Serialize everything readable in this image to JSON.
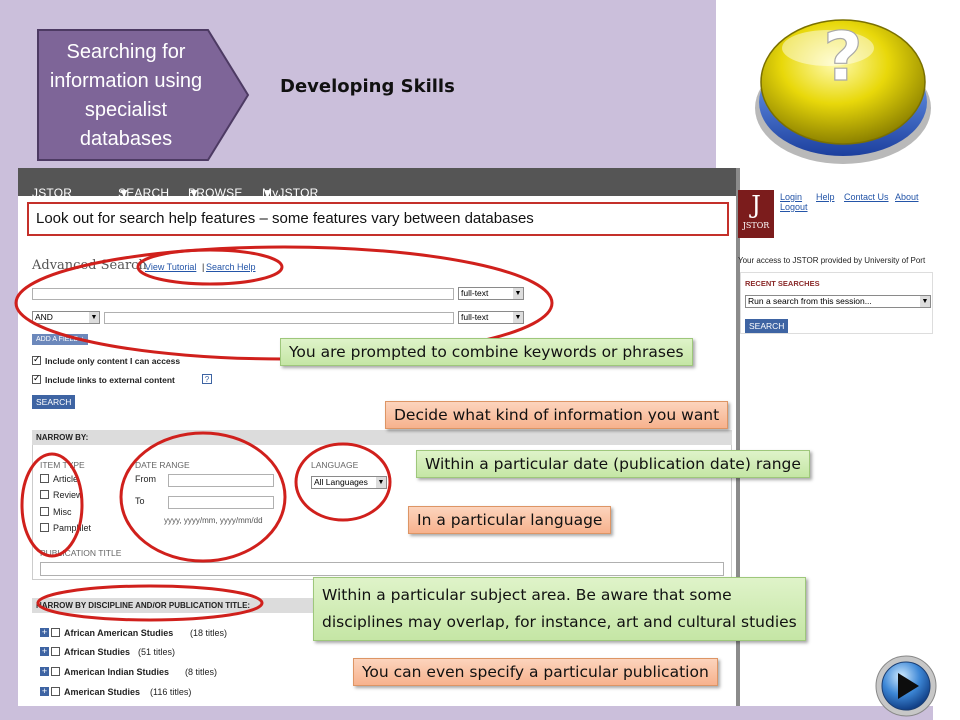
{
  "slide": {
    "arrow_title": "Searching for information using specialist databases",
    "subtitle": "Developing Skills"
  },
  "jstor": {
    "nav": [
      {
        "label": "JSTOR HOME",
        "dropdown": false
      },
      {
        "label": "SEARCH",
        "dropdown": true
      },
      {
        "label": "BROWSE",
        "dropdown": true
      },
      {
        "label": "MyJSTOR",
        "dropdown": true
      }
    ],
    "logo_text": "JSTOR",
    "account_links": [
      "Login",
      "Help",
      "Contact Us",
      "About",
      "Logout"
    ],
    "access_text": "Your access to JSTOR provided by University of Port",
    "recent_searches": {
      "header": "RECENT SEARCHES",
      "select_value": "Run a search from this session...",
      "button": "SEARCH"
    },
    "advanced_search": {
      "title": "Advanced Search",
      "view_tutorial": "View Tutorial",
      "separator": "|",
      "search_help": "Search Help",
      "row1_scope": "full-text",
      "row2_operator": "AND",
      "row2_scope": "full-text",
      "add_field": "ADD A FIELD",
      "checkbox1": "Include only content I can access",
      "checkbox2": "Include links to external content",
      "search_button": "SEARCH"
    },
    "narrow_by": {
      "header": "NARROW BY:",
      "item_type_label": "ITEM TYPE",
      "item_types": [
        "Article",
        "Review",
        "Misc",
        "Pamphlet"
      ],
      "date_range_label": "DATE RANGE",
      "from_label": "From",
      "to_label": "To",
      "date_hint": "yyyy, yyyy/mm, yyyy/mm/dd",
      "language_label": "LANGUAGE",
      "language_value": "All Languages",
      "publication_title_label": "PUBLICATION TITLE"
    },
    "discipline": {
      "header": "NARROW BY DISCIPLINE AND/OR PUBLICATION TITLE:",
      "items": [
        {
          "name": "African American Studies",
          "count": "(18 titles)"
        },
        {
          "name": "African Studies",
          "count": "(51 titles)"
        },
        {
          "name": "American Indian Studies",
          "count": "(8 titles)"
        },
        {
          "name": "American Studies",
          "count": "(116 titles)"
        }
      ]
    }
  },
  "callouts": {
    "help": "Look out for search help features – some features vary between databases",
    "combine": "You are prompted to combine keywords or phrases",
    "decide": "Decide what kind of information you want",
    "date": "Within a particular date (publication date) range",
    "language": "In a particular language",
    "subject_line1": "Within a particular subject area. Be aware that some",
    "subject_line2": "disciplines may overlap, for instance, art and cultural studies",
    "publication": "You can even specify a particular publication"
  },
  "icons": {
    "question_button": "question-mark-icon",
    "play_button": "play-icon"
  },
  "colors": {
    "arrow_fill": "#7e6598",
    "background": "#cbbfdb",
    "highlight_red": "#d0201c",
    "green_callout": "#c5e6a5",
    "orange_callout": "#f7b28d"
  }
}
